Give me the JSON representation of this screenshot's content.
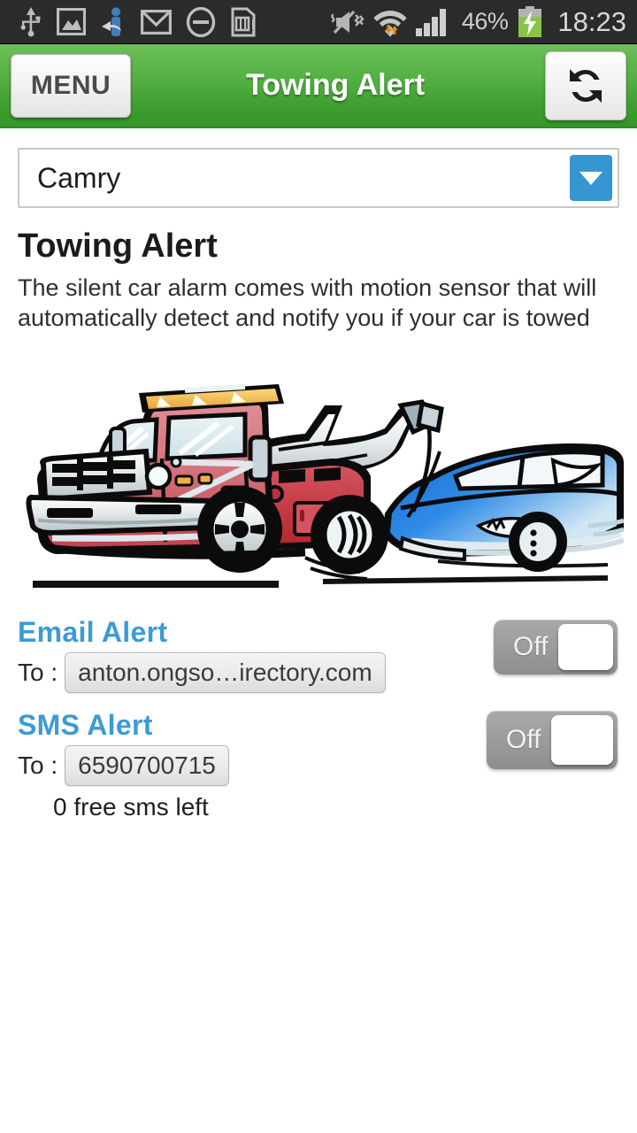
{
  "statusbar": {
    "icons_left": [
      "usb-icon",
      "image-icon",
      "person-share-icon",
      "gmail-icon",
      "do-not-disturb-icon",
      "sd-card-icon"
    ],
    "icons_right": [
      "mute-vibrate-icon",
      "wifi-icon",
      "signal-bars-icon"
    ],
    "battery_percent": "46%",
    "battery_icon": "battery-charging-icon",
    "clock": "18:23"
  },
  "actionbar": {
    "menu_label": "MENU",
    "title": "Towing Alert",
    "refresh_icon": "refresh-icon"
  },
  "vehicle_select": {
    "value": "Camry",
    "arrow_icon": "chevron-down-icon"
  },
  "main": {
    "heading": "Towing Alert",
    "description": "The silent car alarm comes with motion sensor that will automatically detect and notify you if your car is towed",
    "illustration": "tow-truck-illustration"
  },
  "email_alert": {
    "heading": "Email Alert",
    "to_label": "To :",
    "address": "anton.ongso…irectory.com",
    "toggle_state": "Off"
  },
  "sms_alert": {
    "heading": "SMS Alert",
    "to_label": "To :",
    "number": "6590700715",
    "note": "0 free sms left",
    "toggle_state": "Off"
  },
  "colors": {
    "actionbar_green": "#54b043",
    "accent_blue": "#3c9bd4",
    "dropdown_blue": "#3596d2",
    "statusbar_dark": "#2b2b2b",
    "toggle_grey": "#9c9c9c"
  }
}
